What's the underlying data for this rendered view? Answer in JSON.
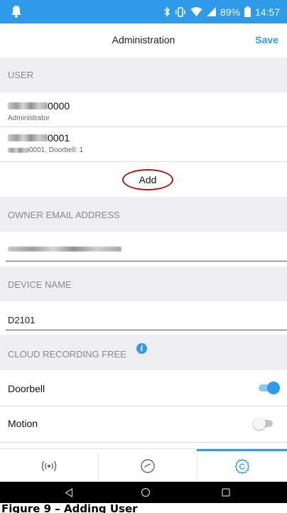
{
  "status_bar": {
    "battery_percent": "89%",
    "time": "14:57",
    "icons": [
      "notification-bell-icon",
      "bluetooth-icon",
      "vibrate-icon",
      "wifi-icon",
      "cell-signal-icon",
      "battery-icon"
    ]
  },
  "header": {
    "title": "Administration",
    "save_label": "Save"
  },
  "user_section": {
    "header": "USER",
    "users": [
      {
        "name": "0000",
        "subtitle": "Administrator"
      },
      {
        "name": "0001",
        "subtitle": "0001, Doorbell: 1"
      }
    ],
    "add_label": "Add"
  },
  "owner_email": {
    "header": "OWNER EMAIL ADDRESS"
  },
  "device_name": {
    "header": "DEVICE NAME",
    "value": "D2101"
  },
  "cloud_recording": {
    "header": "CLOUD RECORDING FREE",
    "toggles": [
      {
        "label": "Doorbell",
        "on": true
      },
      {
        "label": "Motion",
        "on": false
      }
    ]
  },
  "tab_bar": {
    "tabs": [
      {
        "icon": "live-broadcast-icon",
        "active": false
      },
      {
        "icon": "history-clock-icon",
        "active": false
      },
      {
        "icon": "settings-gear-icon",
        "active": true
      }
    ]
  },
  "nav_bar": {
    "buttons": [
      "back-icon",
      "home-icon",
      "recents-icon"
    ]
  },
  "caption": "Figure 9 – Adding User",
  "colors": {
    "accent": "#2f9ae8",
    "section_bg": "#efeff1",
    "highlight_ring": "#b01818"
  }
}
